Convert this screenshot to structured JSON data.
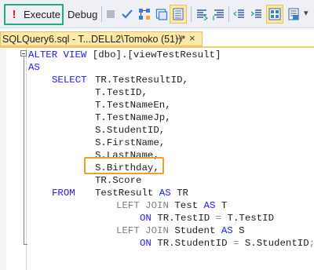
{
  "toolbar": {
    "execute_label": "Execute",
    "debug_label": "Debug"
  },
  "tab": {
    "title": "SQLQuery6.sql - T...DELL2\\Tomoko (51))*",
    "pin": "⊣",
    "close": "×"
  },
  "code": {
    "l1_alter": "ALTER VIEW",
    "l1_rest": " [dbo].[viewTestResult]",
    "l2": "AS",
    "l3_kw": "SELECT",
    "l3_col": "TR.TestResultID,",
    "l4": "T.TestID,",
    "l5": "T.TestNameEn,",
    "l6": "T.TestNameJp,",
    "l7": "S.StudentID,",
    "l8": "S.FirstName,",
    "l9": "S.LastName,",
    "l10": "S.Birthday,",
    "l11": "TR.Score",
    "l12_kw": "FROM",
    "l12_rest": "TestResult",
    "l12_as": "AS",
    "l12_alias": "TR",
    "l13_kw": "LEFT JOIN",
    "l13_rest": "Test",
    "l13_as": "AS",
    "l13_alias": "T",
    "l14_on": "ON",
    "l14_rest": "TR.TestID",
    "l14_eq": "=",
    "l14_rhs": "T.TestID",
    "l15_kw": "LEFT JOIN",
    "l15_rest": "Student",
    "l15_as": "AS",
    "l15_alias": "S",
    "l16_on": "ON",
    "l16_rest": "TR.StudentID",
    "l16_eq": "=",
    "l16_rhs": "S.StudentID",
    "l16_end": ";"
  },
  "colors": {
    "keyword": "#1a1aff",
    "operator": "#808080",
    "tab_active": "#ffe9a8",
    "execute_frame": "#1fae84",
    "highlight_frame": "#eda02f"
  }
}
